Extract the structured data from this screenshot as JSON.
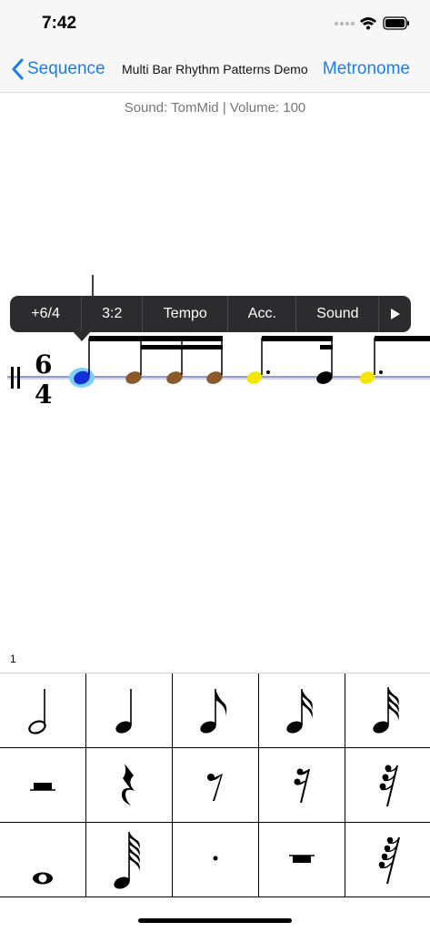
{
  "status": {
    "time": "7:42",
    "icons": [
      "signal-dots-icon",
      "wifi-icon",
      "battery-icon"
    ]
  },
  "nav": {
    "back_label": "Sequence",
    "title": "Multi Bar Rhythm Patterns Demo",
    "right_label": "Metronome",
    "accent": "#1a7cf5"
  },
  "sound_info": "Sound: TomMid | Volume: 100",
  "staff": {
    "time_signature": {
      "top": "6",
      "bottom": "4"
    },
    "note_colors": {
      "selected": "#1230d8",
      "highlight": "#7fd0f5",
      "brown": "#8b5a2b",
      "yellow": "#f5e600",
      "black": "#000000"
    }
  },
  "popup_menu": {
    "items": [
      "+6/4",
      "3:2",
      "Tempo",
      "Acc.",
      "Sound"
    ],
    "more_icon": "play-right-icon"
  },
  "bar_number": "1",
  "palette": {
    "rows": [
      [
        "half-note-icon",
        "quarter-note-icon",
        "eighth-note-icon",
        "sixteenth-note-icon",
        "thirty-second-note-icon"
      ],
      [
        "half-rest-icon",
        "quarter-rest-icon",
        "eighth-rest-icon",
        "sixteenth-rest-icon",
        "thirty-second-rest-icon"
      ],
      [
        "whole-note-icon",
        "sixty-fourth-note-icon",
        "dot-icon",
        "whole-rest-icon",
        "sixty-fourth-rest-icon"
      ]
    ]
  }
}
